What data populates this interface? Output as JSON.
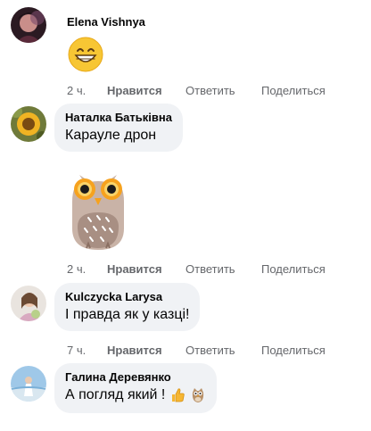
{
  "comments": [
    {
      "author": "Elena Vishnya",
      "text": "",
      "sticker": "grinning-emoji",
      "time": "2 ч.",
      "like": "Нравится",
      "reply": "Ответить",
      "share": "Поделиться"
    },
    {
      "author": "Наталка Батьківна",
      "text": "Карауле дрон",
      "sticker": "owl-sticker",
      "time": "2 ч.",
      "like": "Нравится",
      "reply": "Ответить",
      "share": "Поделиться"
    },
    {
      "author": "Kulczycka Larysa",
      "text": "І правда як у казці!",
      "time": "7 ч.",
      "like": "Нравится",
      "reply": "Ответить",
      "share": "Поделиться"
    },
    {
      "author": "Галина Деревянко",
      "text": "А погляд який !",
      "text_emojis": [
        "thumbs-up-emoji",
        "owl-emoji"
      ]
    }
  ],
  "colors": {
    "bubble": "#f0f2f5",
    "meta": "#65676b",
    "text": "#050505"
  }
}
